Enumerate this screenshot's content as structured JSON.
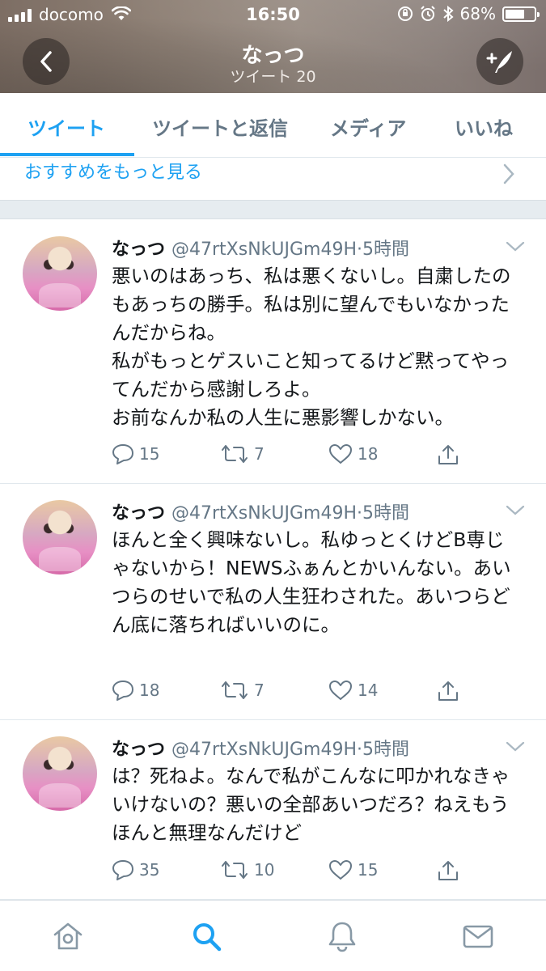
{
  "status_bar": {
    "carrier": "docomo",
    "time": "16:50",
    "battery": "68%",
    "battery_level": 0.68
  },
  "header": {
    "name": "なっつ",
    "tweet_count": "ツイート 20",
    "back_icon": "chevron-left-icon",
    "compose_icon": "compose-tweet-icon"
  },
  "tabs": [
    "ツイート",
    "ツイートと返信",
    "メディア",
    "いいね"
  ],
  "more": {
    "label": "おすすめをもっと見る"
  },
  "tweets": [
    {
      "name": "なっつ",
      "handle": "@47rtXsNkUJGm49H",
      "dot": "·",
      "time": "5時間",
      "text": "悪いのはあっち、私は悪くないし。自粛したのもあっちの勝手。私は別に望んでもいなかったんだからね。\n私がもっとゲスいこと知ってるけど黙ってやってんだから感謝しろよ。\nお前なんか私の人生に悪影響しかない。",
      "replies": "15",
      "retweets": "7",
      "likes": "18"
    },
    {
      "name": "なっつ",
      "handle": "@47rtXsNkUJGm49H",
      "dot": "·",
      "time": "5時間",
      "text": "ほんと全く興味ないし。私ゆっとくけどB専じゃないから！NEWSふぁんとかいんない。あいつらのせいで私の人生狂わされた。あいつらどん底に落ちればいいのに。",
      "replies": "18",
      "retweets": "7",
      "likes": "14"
    },
    {
      "name": "なっつ",
      "handle": "@47rtXsNkUJGm49H",
      "dot": "·",
      "time": "5時間",
      "text": "は？死ねよ。なんで私がこんなに叩かれなきゃいけないの？悪いの全部あいつだろ？ねえもうほんと無理なんだけど",
      "replies": "35",
      "retweets": "10",
      "likes": "15"
    }
  ],
  "tabbar": [
    "home-icon",
    "search-icon",
    "notifications-bell-icon",
    "messages-envelope-icon"
  ],
  "colors": {
    "accent": "#1da1f2",
    "secondary_text": "#657786",
    "primary_text": "#14171a"
  }
}
